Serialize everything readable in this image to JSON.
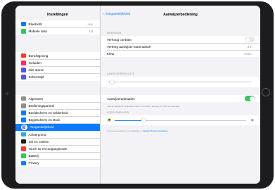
{
  "status": {
    "time": "11:36",
    "date": "Di 13 okt.",
    "battery": "100%"
  },
  "sidebar": {
    "title": "Instellingen",
    "group1": [
      {
        "label": "Bluetooth",
        "value": "Aan",
        "icon": "bluetooth-icon",
        "color": "#0a7aff"
      },
      {
        "label": "Mobiele data",
        "value": "Uit",
        "icon": "antenna-icon",
        "color": "#34c759"
      }
    ],
    "group2": [
      {
        "label": "Berichtgeving",
        "icon": "notifications-icon",
        "color": "#ff3b30"
      },
      {
        "label": "Geluiden",
        "icon": "speaker-icon",
        "color": "#ff2d55"
      },
      {
        "label": "Niet storen",
        "icon": "moon-icon",
        "color": "#5856d6"
      },
      {
        "label": "Schermtijd",
        "icon": "hourglass-icon",
        "color": "#5856d6"
      }
    ],
    "group3": [
      {
        "label": "Algemeen",
        "icon": "gear-icon",
        "color": "#8e8e93"
      },
      {
        "label": "Bedieningspaneel",
        "icon": "switches-icon",
        "color": "#8e8e93"
      },
      {
        "label": "Beeldscherm en helderheid",
        "icon": "text-size-icon",
        "color": "#0a7aff"
      },
      {
        "label": "Beginscherm en Dock",
        "icon": "grid-icon",
        "color": "#0a7aff"
      },
      {
        "label": "Toegankelijkheid",
        "icon": "accessibility-icon",
        "color": "#0a7aff",
        "selected": true
      },
      {
        "label": "Achtergrond",
        "icon": "wallpaper-icon",
        "color": "#34aadc"
      },
      {
        "label": "Siri en zoeken",
        "icon": "siri-icon",
        "color": "#1c1c1e"
      },
      {
        "label": "Touch ID en toegangscode",
        "icon": "fingerprint-icon",
        "color": "#ff3b30"
      },
      {
        "label": "Batterij",
        "icon": "battery-icon",
        "color": "#34c759"
      },
      {
        "label": "Privacy",
        "icon": "hand-icon",
        "color": "#0a7aff"
      }
    ]
  },
  "detail": {
    "back_label": "Toegankelijkheid",
    "title": "Aanwijzerbediening",
    "section_contrast": "WEERGAVE",
    "rows_contrast": [
      {
        "label": "Verhoog contrast",
        "kind": "toggle",
        "on": false
      },
      {
        "label": "Verberg aanwijzer automatisch",
        "value": "2 s",
        "kind": "value"
      },
      {
        "label": "Kleur",
        "value": "Geen",
        "kind": "value"
      }
    ],
    "section_size": "AANWIJZERGROOTTE",
    "size_level": 0.02,
    "animations_label": "Aanwijzeranimaties",
    "animations_on": true,
    "animations_footer": "Laat de aanwijzer veranderen als je het scherm aanwijst en zich erop aanpast.",
    "section_speed": "SCROLSNELHEID",
    "speed_level": 0.22,
    "footer_prefix": "Knoppenaanpassen met apparaten in",
    "footer_link": "AssistiveTouch-instellingen"
  },
  "colors": {
    "accent": "#0a7aff",
    "toggle_on": "#34c759",
    "toggle_off": "#e5e5ea"
  }
}
